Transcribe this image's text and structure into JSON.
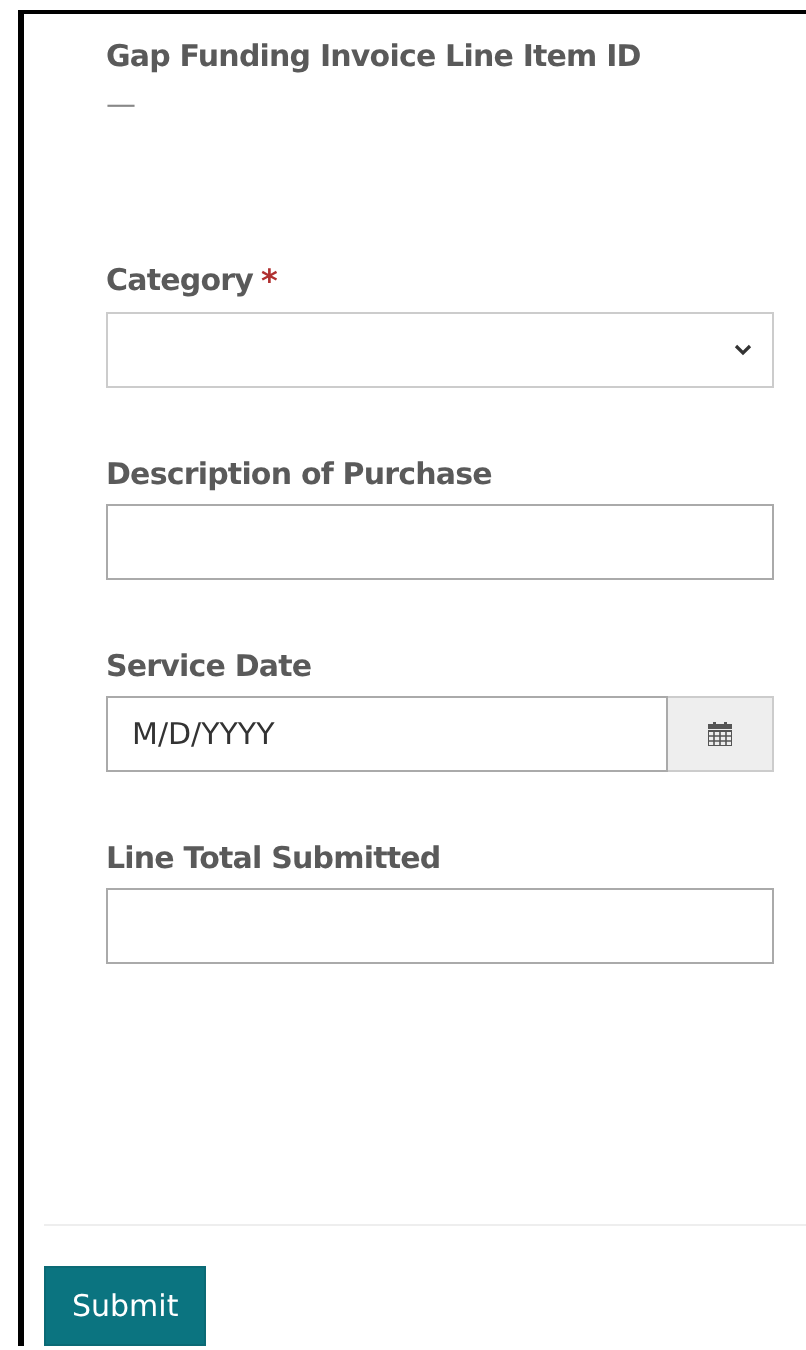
{
  "fields": [
    {
      "kind": "readonly",
      "label": "Gap Funding Invoice Line Item ID",
      "value": "—"
    },
    {
      "kind": "select",
      "label": "Category",
      "required_mark": "*"
    },
    {
      "kind": "text",
      "label": "Description of Purchase"
    },
    {
      "kind": "date",
      "label": "Service Date",
      "placeholder": "M/D/YYYY"
    },
    {
      "kind": "text",
      "label": "Line Total Submitted"
    }
  ],
  "submit_button": "Submit"
}
